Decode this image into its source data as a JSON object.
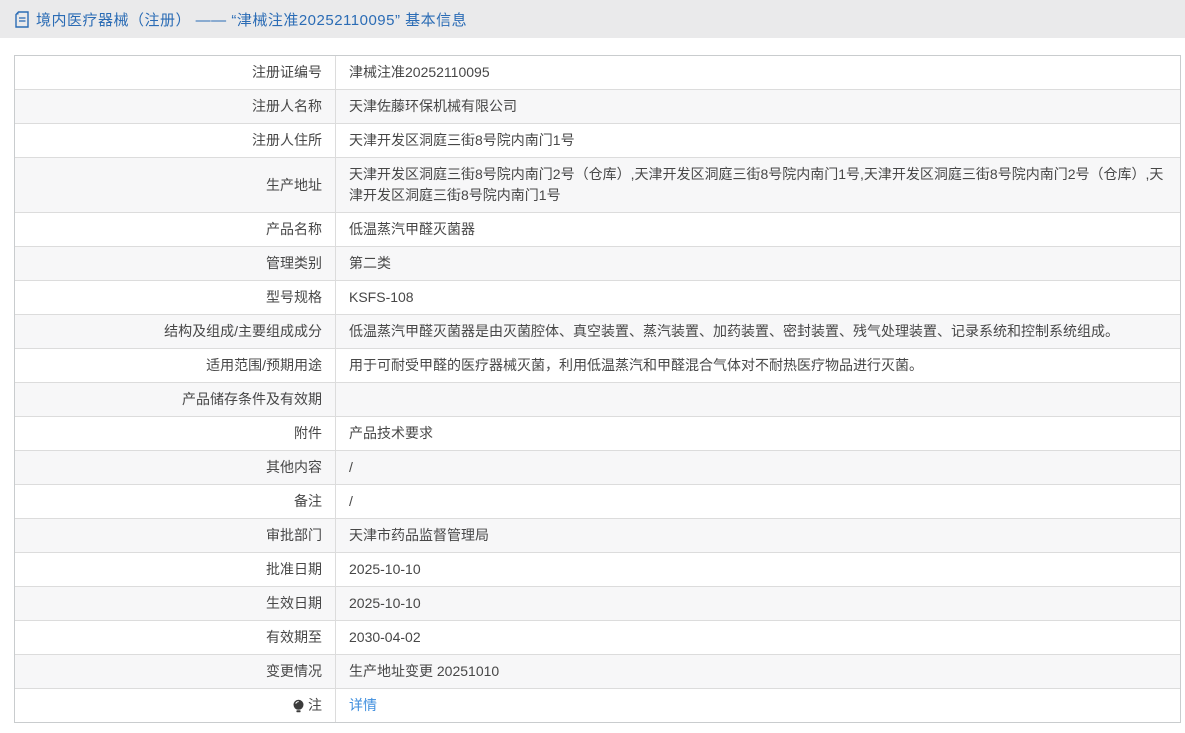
{
  "header": {
    "title": "境内医疗器械（注册） —— “津械注准20252110095” 基本信息",
    "icon": "document-icon"
  },
  "colors": {
    "title_blue": "#2b6cb5",
    "link_blue": "#3e8ede",
    "topbar_bg": "#eaeaeb",
    "alt_row_bg": "#f7f7f8",
    "border": "#dcdcdc"
  },
  "table": {
    "rows": [
      {
        "label": "注册证编号",
        "value": "津械注准20252110095"
      },
      {
        "label": "注册人名称",
        "value": "天津佐藤环保机械有限公司"
      },
      {
        "label": "注册人住所",
        "value": "天津开发区洞庭三街8号院内南门1号"
      },
      {
        "label": "生产地址",
        "value": "天津开发区洞庭三街8号院内南门2号（仓库）,天津开发区洞庭三街8号院内南门1号,天津开发区洞庭三街8号院内南门2号（仓库）,天津开发区洞庭三街8号院内南门1号"
      },
      {
        "label": "产品名称",
        "value": "低温蒸汽甲醛灭菌器"
      },
      {
        "label": "管理类别",
        "value": "第二类"
      },
      {
        "label": "型号规格",
        "value": "KSFS-108"
      },
      {
        "label": "结构及组成/主要组成成分",
        "value": "低温蒸汽甲醛灭菌器是由灭菌腔体、真空装置、蒸汽装置、加药装置、密封装置、残气处理装置、记录系统和控制系统组成。"
      },
      {
        "label": "适用范围/预期用途",
        "value": "用于可耐受甲醛的医疗器械灭菌，利用低温蒸汽和甲醛混合气体对不耐热医疗物品进行灭菌。"
      },
      {
        "label": "产品储存条件及有效期",
        "value": ""
      },
      {
        "label": "附件",
        "value": "产品技术要求"
      },
      {
        "label": "其他内容",
        "value": "/"
      },
      {
        "label": "备注",
        "value": "/"
      },
      {
        "label": "审批部门",
        "value": "天津市药品监督管理局"
      },
      {
        "label": "批准日期",
        "value": "2025-10-10"
      },
      {
        "label": "生效日期",
        "value": "2025-10-10"
      },
      {
        "label": "有效期至",
        "value": "2030-04-02"
      },
      {
        "label": "变更情况",
        "value": "生产地址变更 20251010"
      },
      {
        "label": "注",
        "value": "详情",
        "value_type": "link",
        "label_icon": "bulb-icon"
      }
    ]
  }
}
